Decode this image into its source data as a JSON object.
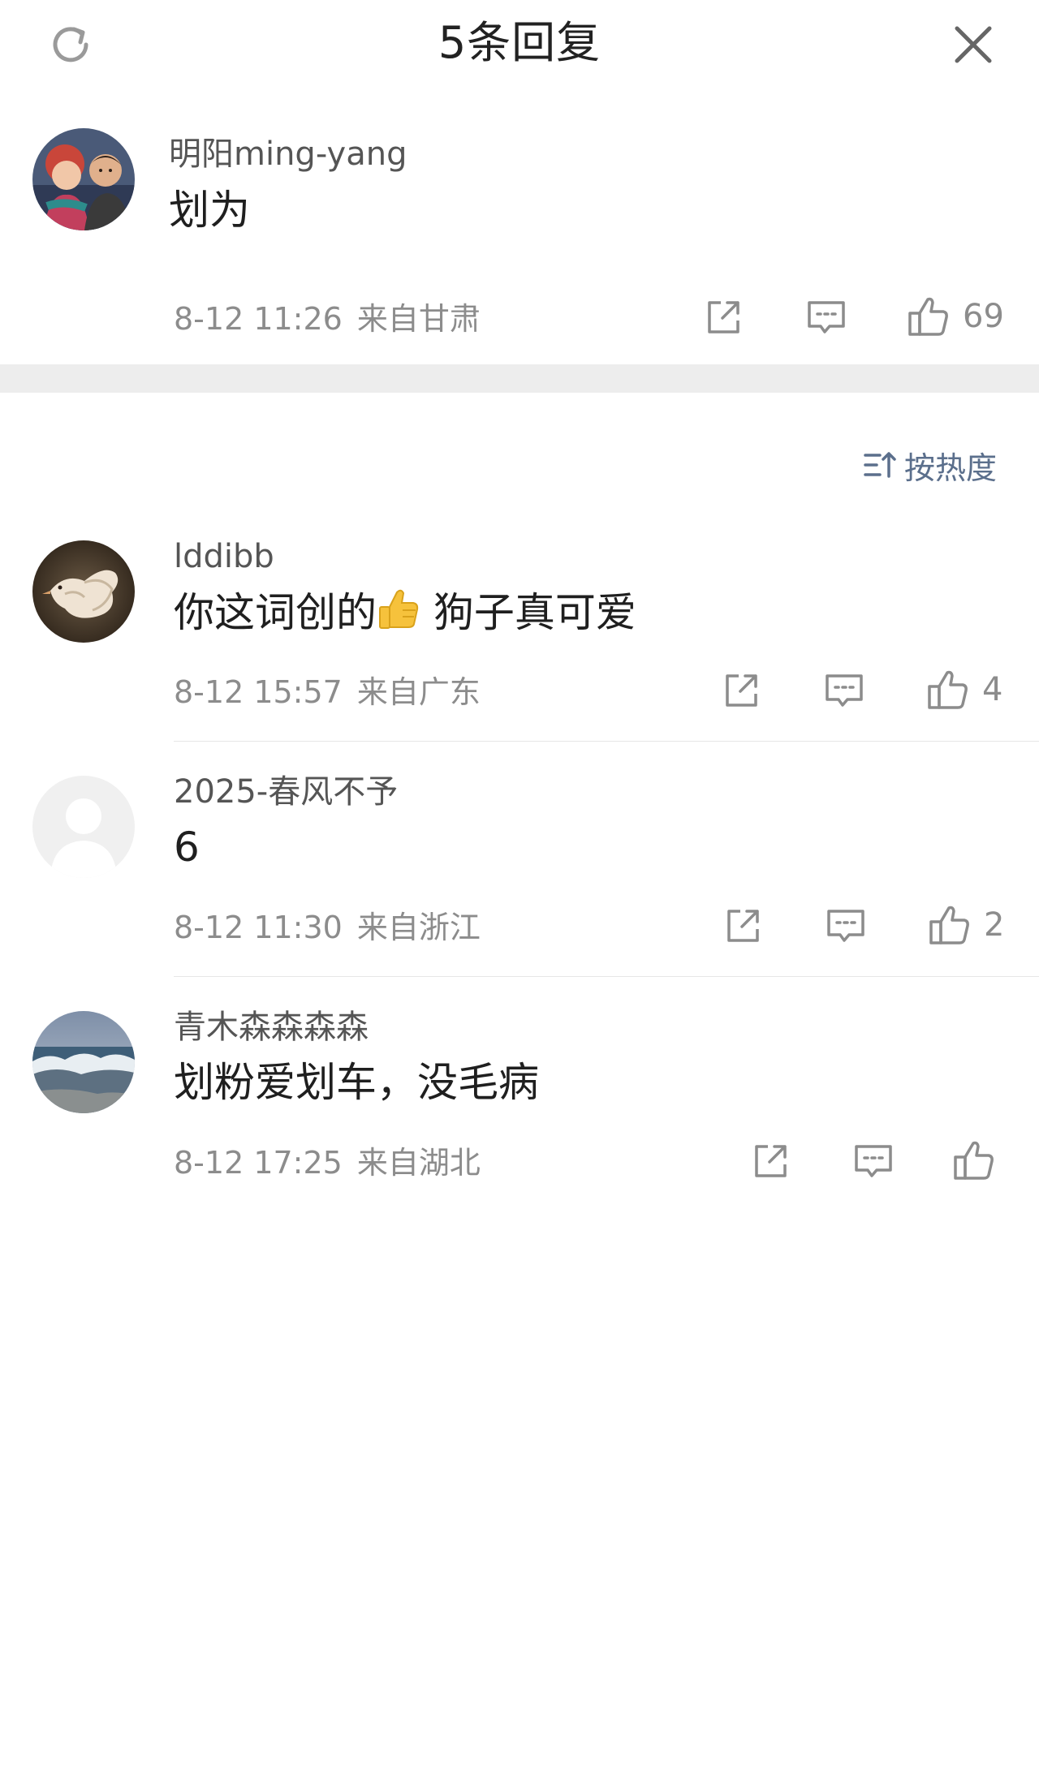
{
  "header": {
    "title": "5条回复",
    "refresh_icon": "refresh-icon",
    "close_icon": "close-icon"
  },
  "root_comment": {
    "username": "明阳ming-yang",
    "content": "划为",
    "date": "8-12 11:26",
    "location": "来自甘肃",
    "likes": "69"
  },
  "sort": {
    "label": "按热度",
    "icon": "sort-icon"
  },
  "replies": [
    {
      "username": "lddibb",
      "content_before": "你这词创的",
      "content_emoji": "thumbs-up-emoji",
      "content_after": " 狗子真可爱",
      "date": "8-12 15:57",
      "location": "来自广东",
      "likes": "4"
    },
    {
      "username": "2025-春风不予",
      "content": "6",
      "date": "8-12 11:30",
      "location": "来自浙江",
      "likes": "2"
    },
    {
      "username": "青木森森森森",
      "content": "划粉爱划车，没毛病",
      "date": "8-12 17:25",
      "location": "来自湖北",
      "likes": ""
    }
  ],
  "colors": {
    "accent": "#5b6f8c",
    "meta_text": "#8c8c8c",
    "section_gap": "#ededed"
  }
}
